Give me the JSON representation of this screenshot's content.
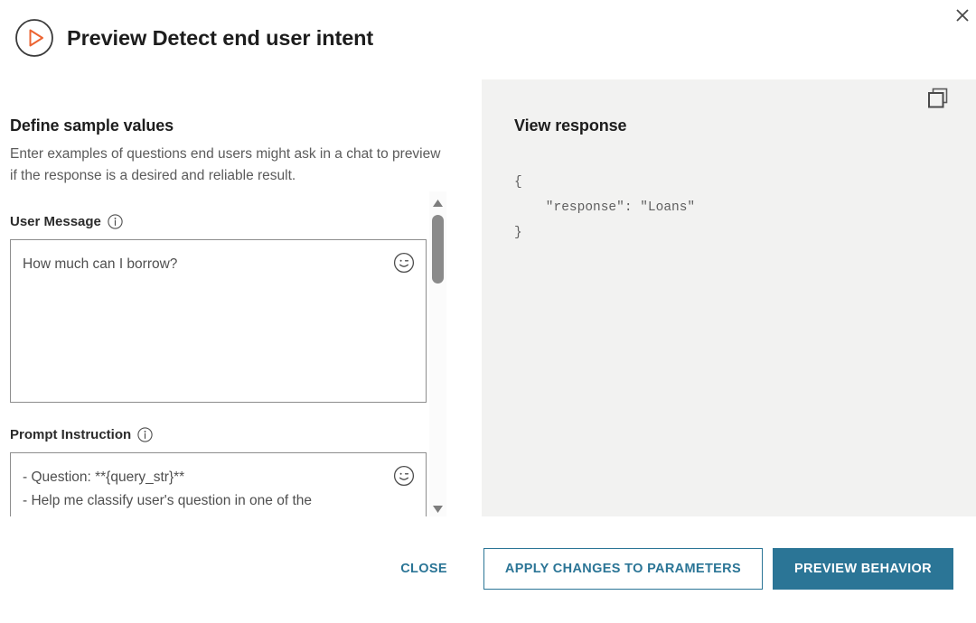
{
  "window": {
    "close_icon": "close-icon"
  },
  "header": {
    "icon": "play-circle-icon",
    "title": "Preview Detect end user intent",
    "accent_orange": "#EC6432"
  },
  "left": {
    "section_title": "Define sample values",
    "section_desc": "Enter examples of questions end users might ask in a chat to preview if the response is a desired and reliable result.",
    "fields": [
      {
        "label": "User Message",
        "info_icon": "info-icon",
        "value": "How much can I borrow?",
        "emoji_icon": "emoji-smiley-wink-icon"
      },
      {
        "label": "Prompt Instruction",
        "info_icon": "info-icon",
        "value": "- Question: **{query_str}**\n- Help me classify user's question in one of the",
        "emoji_icon": "emoji-smiley-wink-icon"
      }
    ],
    "scrollbar": {
      "up_icon": "scroll-up-arrow-icon",
      "down_icon": "scroll-down-arrow-icon"
    }
  },
  "response_panel": {
    "title": "View response",
    "copy_icon": "copy-icon",
    "body": "{\n    \"response\": \"Loans\"\n}"
  },
  "footer": {
    "close_label": "CLOSE",
    "apply_label": "APPLY CHANGES TO PARAMETERS",
    "preview_label": "PREVIEW BEHAVIOR",
    "accent_teal": "#2B7596"
  }
}
